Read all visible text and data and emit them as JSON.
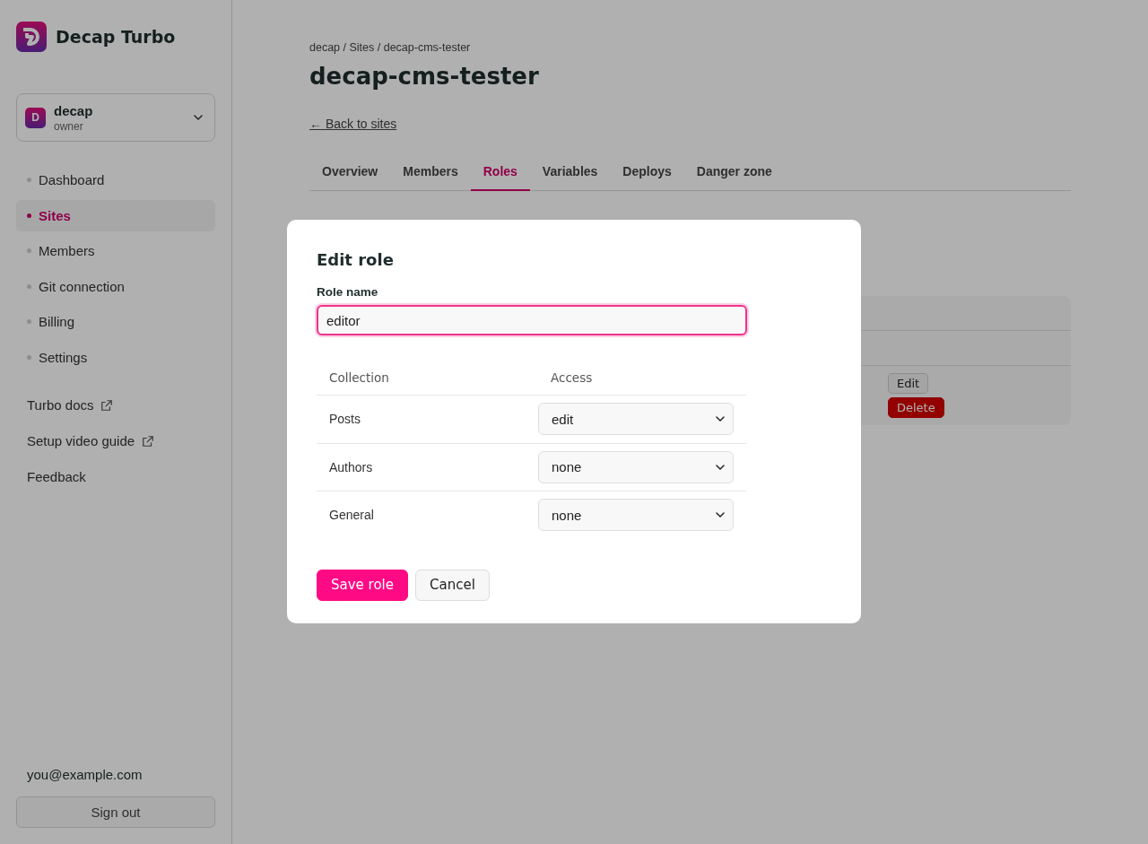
{
  "sidebar": {
    "brand": "Decap Turbo",
    "account": {
      "initial": "D",
      "name": "decap",
      "role": "owner"
    },
    "nav": [
      {
        "label": "Dashboard",
        "selected": false
      },
      {
        "label": "Sites",
        "selected": true
      },
      {
        "label": "Members",
        "selected": false
      },
      {
        "label": "Git connection",
        "selected": false
      },
      {
        "label": "Billing",
        "selected": false
      },
      {
        "label": "Settings",
        "selected": false
      }
    ],
    "links": [
      {
        "label": "Turbo docs",
        "external": true
      },
      {
        "label": "Setup video guide",
        "external": true
      },
      {
        "label": "Feedback",
        "external": false
      }
    ],
    "user_email": "you@example.com",
    "sign_out": "Sign out"
  },
  "page": {
    "breadcrumb": "decap / Sites / decap-cms-tester",
    "title": "decap-cms-tester",
    "back_link": "← Back to sites",
    "tabs": [
      {
        "label": "Overview",
        "selected": false
      },
      {
        "label": "Members",
        "selected": false
      },
      {
        "label": "Roles",
        "selected": true
      },
      {
        "label": "Variables",
        "selected": false
      },
      {
        "label": "Deploys",
        "selected": false
      },
      {
        "label": "Danger zone",
        "selected": false
      }
    ],
    "row_actions": [
      {
        "label": "Edit",
        "kind": "secondary"
      },
      {
        "label": "Delete",
        "kind": "danger"
      }
    ]
  },
  "modal": {
    "title": "Edit role",
    "field_label": "Role name",
    "value": "editor",
    "columns": [
      "Collection",
      "Access"
    ],
    "rows": [
      {
        "collection": "Posts",
        "access": "edit"
      },
      {
        "collection": "Authors",
        "access": "none"
      },
      {
        "collection": "General",
        "access": "none"
      }
    ],
    "buttons": [
      {
        "label": "Save role",
        "kind": "primary"
      },
      {
        "label": "Cancel",
        "kind": "secondary"
      }
    ]
  }
}
